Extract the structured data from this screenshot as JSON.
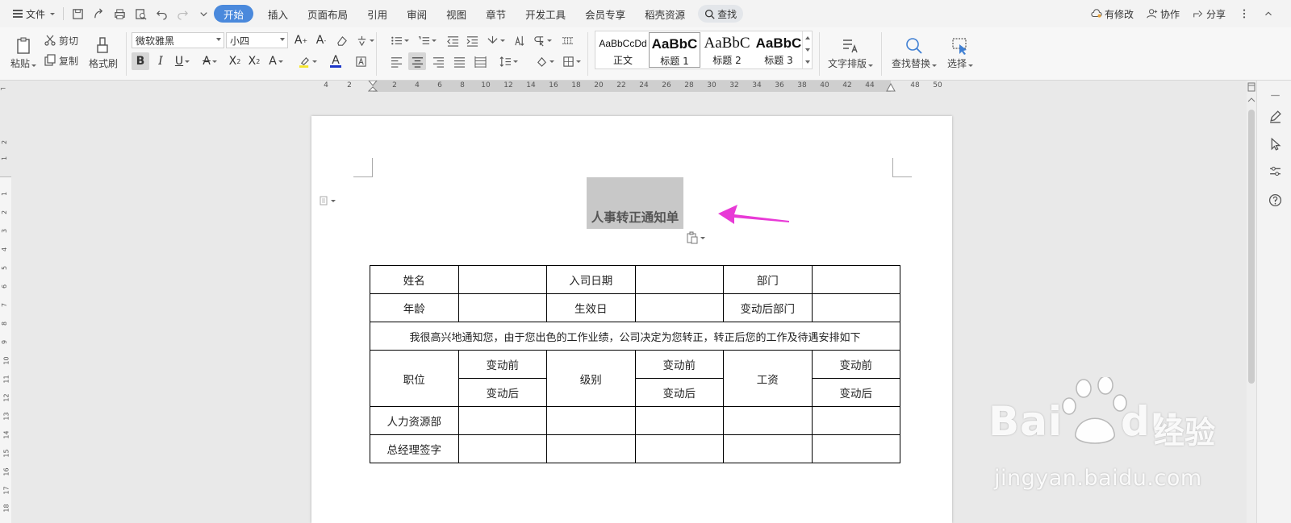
{
  "menubar": {
    "file_label": "文件",
    "tabs": [
      "开始",
      "插入",
      "页面布局",
      "引用",
      "审阅",
      "视图",
      "章节",
      "开发工具",
      "会员专享",
      "稻壳资源"
    ],
    "search_label": "查找",
    "right": {
      "modified_label": "有修改",
      "collab_label": "协作",
      "share_label": "分享"
    }
  },
  "ribbon": {
    "paste_label": "粘贴",
    "cut_label": "剪切",
    "copy_label": "复制",
    "format_painter_label": "格式刷",
    "font_name": "微软雅黑",
    "font_size": "小四",
    "styles": [
      {
        "sample": "AaBbCcDd",
        "name": "正文"
      },
      {
        "sample": "AaBbC",
        "name": "标题 1"
      },
      {
        "sample": "AaBbC",
        "name": "标题 2"
      },
      {
        "sample": "AaBbC",
        "name": "标题 3"
      }
    ],
    "text_layout_label": "文字排版",
    "find_replace_label": "查找替换",
    "select_label": "选择"
  },
  "ruler": {
    "h_numbers": [
      "4",
      "2",
      "2",
      "4",
      "6",
      "8",
      "10",
      "12",
      "14",
      "16",
      "18",
      "20",
      "22",
      "24",
      "26",
      "28",
      "30",
      "32",
      "34",
      "36",
      "38",
      "40",
      "42",
      "44",
      "48",
      "50"
    ],
    "v_numbers": [
      "2",
      "1",
      "1",
      "2",
      "3",
      "4",
      "5",
      "6",
      "7",
      "8",
      "9",
      "10",
      "11",
      "12",
      "13",
      "14",
      "15",
      "16",
      "17",
      "18"
    ]
  },
  "document": {
    "title": "人事转正通知单",
    "table": {
      "row1": [
        "姓名",
        "",
        "入司日期",
        "",
        "部门",
        ""
      ],
      "row2": [
        "年龄",
        "",
        "生效日",
        "",
        "变动后部门",
        ""
      ],
      "notice": "我很高兴地通知您，由于您出色的工作业绩，公司决定为您转正，转正后您的工作及待遇安排如下",
      "position_label": "职位",
      "level_label": "级别",
      "salary_label": "工资",
      "before_label": "变动前",
      "after_label": "变动后",
      "row5_label": "人力资源部",
      "row6_label": "总经理签字"
    }
  },
  "watermark": {
    "brand": "Bai",
    "brand_end": "du",
    "cn": "经验",
    "url": "jingyan.baidu.com"
  },
  "colors": {
    "accent": "#4a89dc",
    "arrow": "#e83ad6",
    "selection": "#c8c8c8"
  }
}
